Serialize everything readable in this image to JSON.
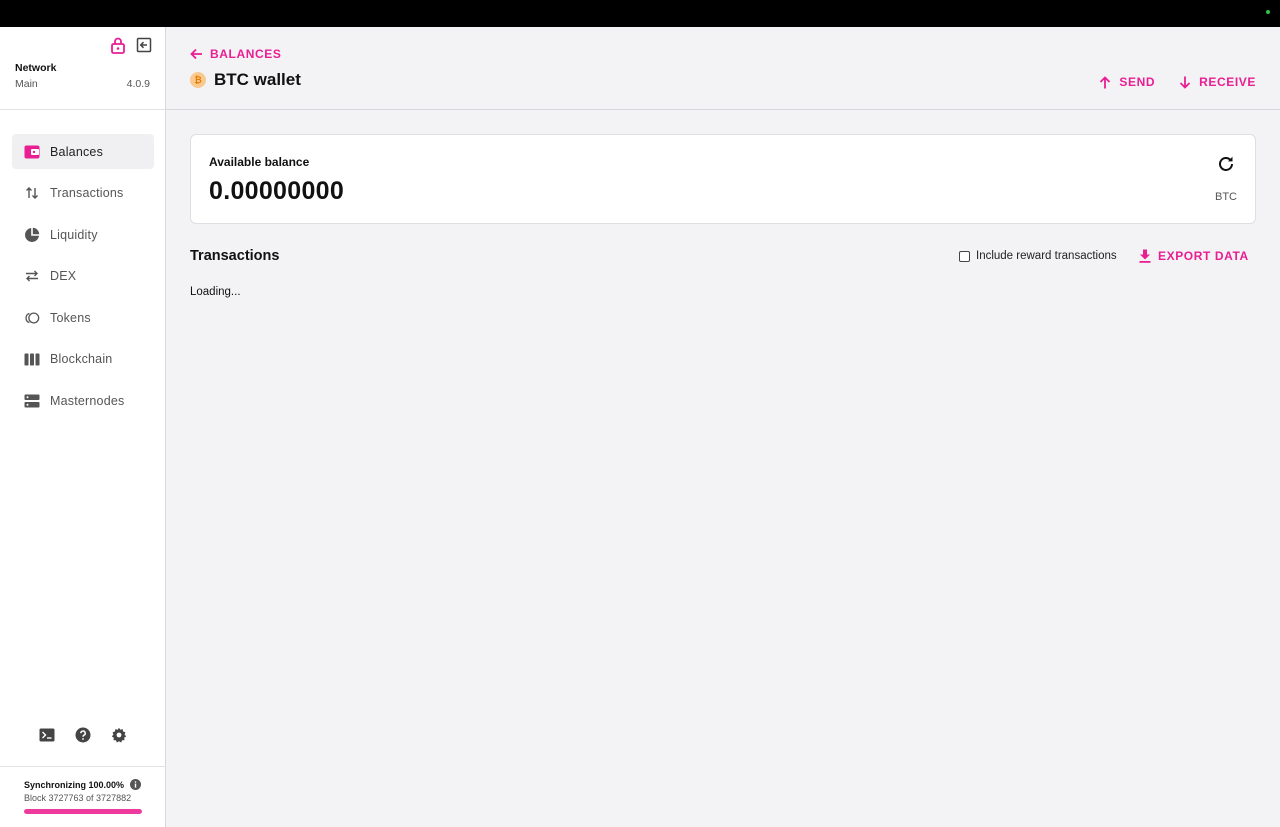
{
  "sidebar": {
    "network_title": "Network",
    "network_name": "Main",
    "version": "4.0.9",
    "items": [
      {
        "label": "Balances",
        "icon": "wallet-icon"
      },
      {
        "label": "Transactions",
        "icon": "swap-vertical-icon"
      },
      {
        "label": "Liquidity",
        "icon": "pie-chart-icon"
      },
      {
        "label": "DEX",
        "icon": "swap-horizontal-icon"
      },
      {
        "label": "Tokens",
        "icon": "tokens-icon"
      },
      {
        "label": "Blockchain",
        "icon": "blocks-icon"
      },
      {
        "label": "Masternodes",
        "icon": "server-icon"
      }
    ],
    "sync": {
      "title": "Synchronizing 100.00%",
      "block": "Block 3727763 of 3727882",
      "progress": 1.0
    }
  },
  "header": {
    "back_label": "BALANCES",
    "title": "BTC wallet",
    "coin_symbol": "₿",
    "send_label": "SEND",
    "receive_label": "RECEIVE"
  },
  "balance": {
    "label": "Available balance",
    "value": "0.00000000",
    "unit": "BTC"
  },
  "transactions": {
    "title": "Transactions",
    "include_reward_label": "Include reward transactions",
    "export_label": "EXPORT DATA",
    "loading": "Loading..."
  },
  "colors": {
    "accent": "#e91e93",
    "sync_bar": "#ee3a9d"
  }
}
